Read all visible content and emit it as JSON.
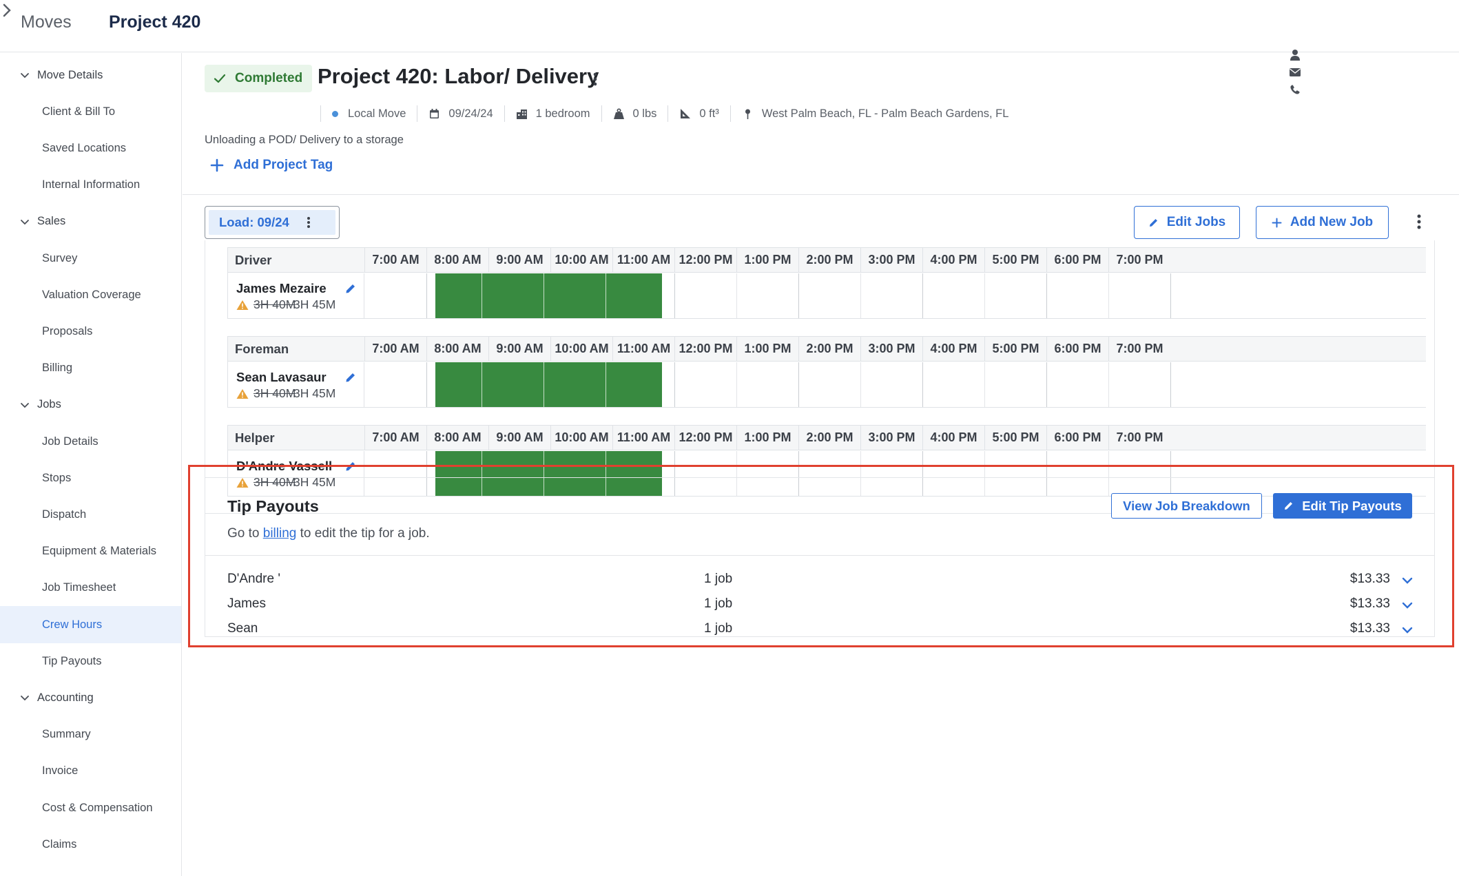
{
  "breadcrumb": {
    "root": "Moves",
    "current": "Project 420"
  },
  "sidebar": {
    "sections": [
      {
        "label": "Move Details",
        "items": [
          "Client & Bill To",
          "Saved Locations",
          "Internal Information"
        ]
      },
      {
        "label": "Sales",
        "items": [
          "Survey",
          "Valuation Coverage",
          "Proposals",
          "Billing"
        ]
      },
      {
        "label": "Jobs",
        "items": [
          "Job Details",
          "Stops",
          "Dispatch",
          "Equipment & Materials",
          "Job Timesheet",
          "Crew Hours",
          "Tip Payouts"
        ]
      },
      {
        "label": "Accounting",
        "items": [
          "Summary",
          "Invoice",
          "Cost & Compensation",
          "Claims"
        ]
      }
    ],
    "active_item": "Crew Hours"
  },
  "project": {
    "status": "Completed",
    "title": "Project 420: Labor/ Delivery",
    "meta": {
      "move_type": "Local Move",
      "date": "09/24/24",
      "size": "1 bedroom",
      "weight": "0 lbs",
      "volume": "0 ft³",
      "route": "West Palm Beach, FL - Palm Beach Gardens, FL"
    },
    "subtitle": "Unloading a POD/ Delivery to a storage",
    "add_tag_label": "Add Project Tag"
  },
  "toolbar": {
    "load_tab": "Load: 09/24",
    "edit_jobs": "Edit Jobs",
    "add_new_job": "Add New Job"
  },
  "schedule": {
    "hours": [
      "7:00 AM",
      "8:00 AM",
      "9:00 AM",
      "10:00 AM",
      "11:00 AM",
      "12:00 PM",
      "1:00 PM",
      "2:00 PM",
      "3:00 PM",
      "4:00 PM",
      "5:00 PM",
      "6:00 PM",
      "7:00 PM"
    ],
    "crews": [
      {
        "role": "Driver",
        "name": "James Mezaire",
        "old_hours": "3H 40M",
        "new_hours": "3H 45M"
      },
      {
        "role": "Foreman",
        "name": "Sean Lavasaur",
        "old_hours": "3H 40M",
        "new_hours": "3H 45M"
      },
      {
        "role": "Helper",
        "name": "D'Andre Vassell",
        "old_hours": "3H 40M",
        "new_hours": "3H 45M"
      }
    ],
    "shift_color": "#388a40"
  },
  "tip_payouts": {
    "title": "Tip Payouts",
    "subtitle_pre": "Go to ",
    "subtitle_link": "billing",
    "subtitle_post": " to edit the tip for a job.",
    "view_breakdown": "View Job Breakdown",
    "edit_payouts": "Edit Tip Payouts",
    "rows": [
      {
        "name": "D'Andre '",
        "jobs": "1 job",
        "amount": "$13.33"
      },
      {
        "name": "James",
        "jobs": "1 job",
        "amount": "$13.33"
      },
      {
        "name": "Sean",
        "jobs": "1 job",
        "amount": "$13.33"
      }
    ]
  },
  "colors": {
    "accent": "#2f6fd6",
    "status_bg": "#e9f5ea",
    "status_text": "#2f7a34",
    "highlight": "#e0402f"
  }
}
